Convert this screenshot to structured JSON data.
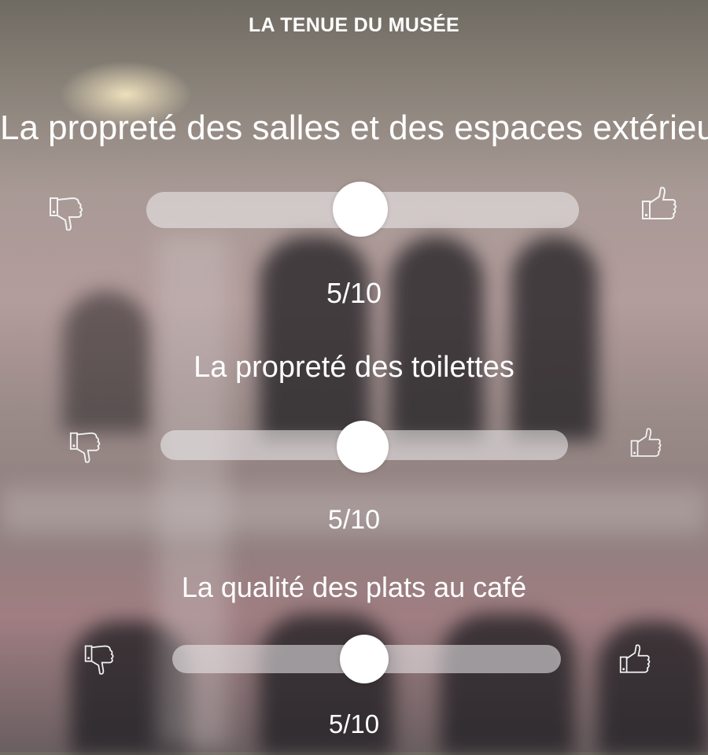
{
  "header": {
    "title": "LA TENUE DU MUSÉE"
  },
  "questions": [
    {
      "label": "La propreté des salles et des espaces extérieu",
      "value": 5,
      "max": 10,
      "score_text": "5/10"
    },
    {
      "label": "La propreté des toilettes",
      "value": 5,
      "max": 10,
      "score_text": "5/10"
    },
    {
      "label": "La qualité des plats au café",
      "value": 5,
      "max": 10,
      "score_text": "5/10"
    }
  ],
  "icons": {
    "low": "thumbs-down-icon",
    "high": "thumbs-up-icon"
  },
  "colors": {
    "text": "#ffffff",
    "thumb": "#ffffff",
    "track": "#ecebee"
  }
}
